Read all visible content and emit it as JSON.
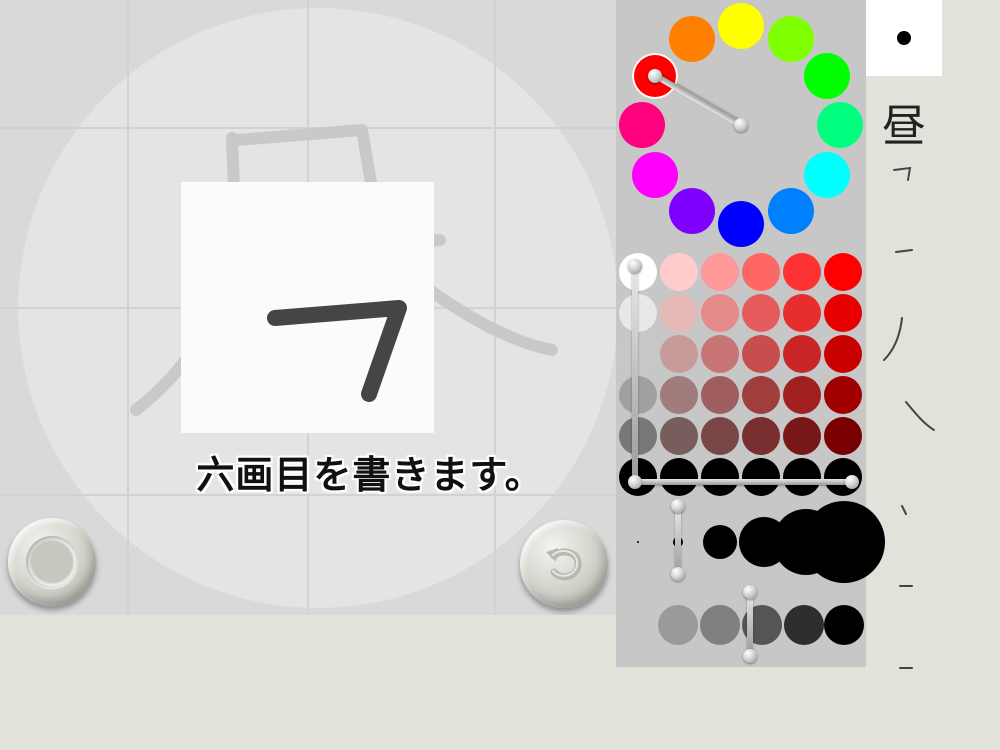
{
  "canvas": {
    "instruction": "六画目を書きます。",
    "guide_kanji": "昼"
  },
  "toolbar": {
    "record_button": "record-icon",
    "undo_button": "undo-arrow-icon"
  },
  "palette": {
    "hue_wheel": [
      "#ff0000",
      "#ff7f00",
      "#ffff00",
      "#7fff00",
      "#00ff00",
      "#00ff7f",
      "#00ffff",
      "#007fff",
      "#0000ff",
      "#7f00ff",
      "#ff00ff",
      "#ff007f"
    ],
    "selected_hue_index": 0,
    "shade_grid": [
      [
        "#ffffff",
        "#ffcccc",
        "#ff9999",
        "#ff6666",
        "#ff3333",
        "#ff0000"
      ],
      [
        "#e8e8e8",
        "#e6b8b8",
        "#e68a8a",
        "#e65c5c",
        "#e62e2e",
        "#e60000"
      ],
      [
        "#c8c8c8",
        "#c89b9b",
        "#c87474",
        "#c84d4d",
        "#c82626",
        "#c80000"
      ],
      [
        "#a0a0a0",
        "#a07c7c",
        "#a05d5d",
        "#a03e3e",
        "#a01f1f",
        "#a00000"
      ],
      [
        "#787878",
        "#785d5d",
        "#784646",
        "#782e2e",
        "#781717",
        "#780000"
      ],
      [
        "#000000",
        "#000000",
        "#000000",
        "#000000",
        "#000000",
        "#000000"
      ]
    ],
    "selected_shade": "bottom-left",
    "brush_sizes": [
      2,
      10,
      34,
      50,
      66,
      82
    ],
    "selected_brush_size_index": 1,
    "opacity_levels": [
      "#9a9a9a",
      "#7f7f7f",
      "#555555",
      "#2e2e2e",
      "#000000"
    ],
    "selected_opacity_index": 2
  },
  "preview": {
    "brush_color": "#000000"
  },
  "stroke_order": {
    "kanji": "昼",
    "current_stroke": 6
  }
}
